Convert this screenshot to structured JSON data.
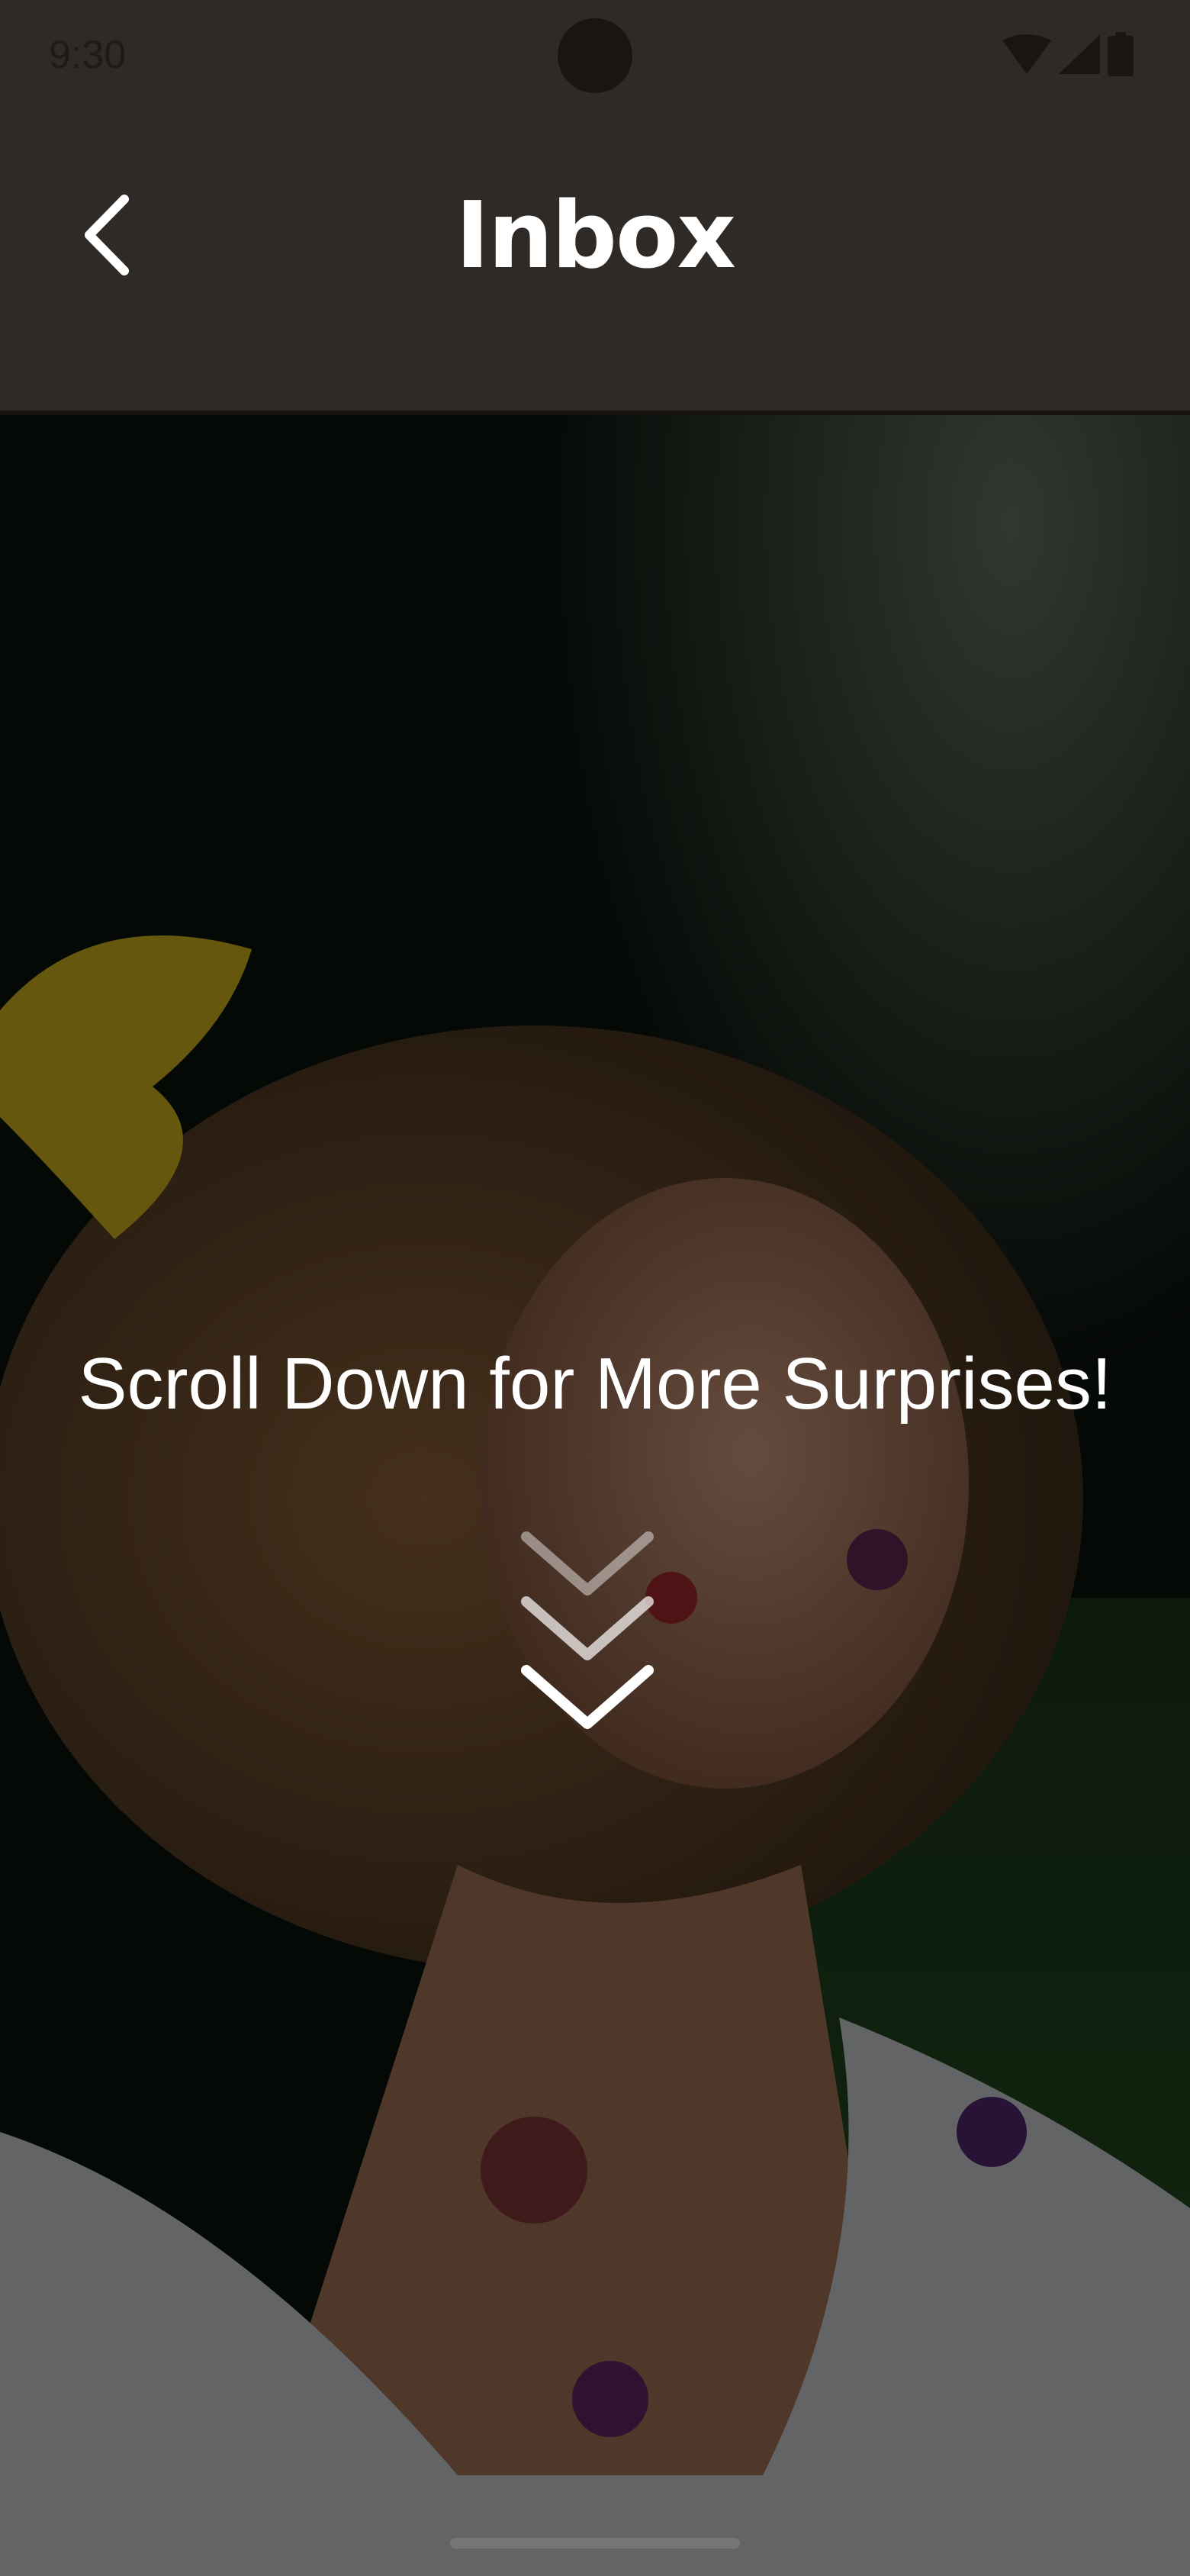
{
  "status_bar": {
    "time": "9:30",
    "icons": [
      "wifi-icon",
      "signal-icon",
      "battery-icon"
    ]
  },
  "app_bar": {
    "title": "Inbox",
    "back_icon": "chevron-left-icon"
  },
  "hero": {
    "message": "Scroll Down for More Surprises!",
    "scroll_icon": "chevron-down-triple-icon"
  },
  "colors": {
    "app_bar_background": "#2f2a26",
    "title_text": "#ffffff",
    "overlay_text": "#ffffff"
  }
}
